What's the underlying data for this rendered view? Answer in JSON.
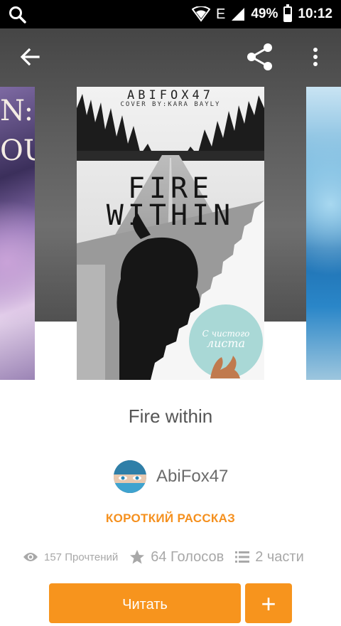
{
  "status_bar": {
    "network": "E",
    "battery": "49%",
    "battery_level": 0.49,
    "time": "10:12"
  },
  "toolbar": {
    "back_icon": "arrow-back-icon",
    "share_icon": "share-icon",
    "more_icon": "more-vert-icon"
  },
  "cover": {
    "author_text": "ABIFOX47",
    "credit_text": "COVER BY:KARA BAYLY",
    "title_line1": "FIRE",
    "title_line2": "WITHIN",
    "badge_text_line1": "С чистого",
    "badge_text_line2": "листа"
  },
  "story": {
    "title": "Fire within",
    "author": "AbiFox47",
    "category": "КОРОТКИЙ РАССКАЗ"
  },
  "stats": {
    "reads": "157 Прочтений",
    "votes": "64 Голосов",
    "parts": "2 части"
  },
  "actions": {
    "read_label": "Читать",
    "add_label": "+"
  },
  "colors": {
    "accent": "#f7941d",
    "category": "#f5901e"
  }
}
